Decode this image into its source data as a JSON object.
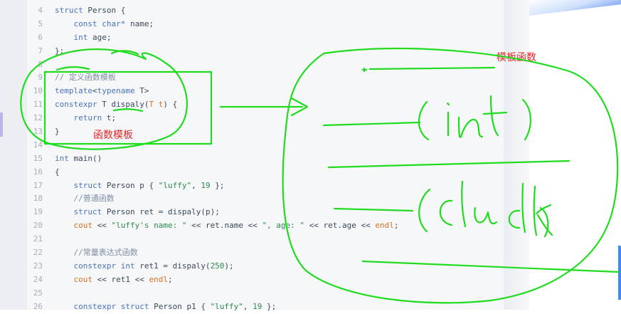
{
  "editor": {
    "lines": [
      {
        "num": "4",
        "parts": [
          [
            "kw",
            "struct"
          ],
          [
            "t",
            " Person {"
          ]
        ]
      },
      {
        "num": "5",
        "parts": [
          [
            "t",
            "    "
          ],
          [
            "kw",
            "const char*"
          ],
          [
            "t",
            " name;"
          ]
        ]
      },
      {
        "num": "6",
        "parts": [
          [
            "t",
            "    "
          ],
          [
            "kw",
            "int"
          ],
          [
            "t",
            " age;"
          ]
        ]
      },
      {
        "num": "7",
        "parts": [
          [
            "t",
            "};"
          ]
        ]
      },
      {
        "num": "8",
        "parts": [
          [
            "t",
            ""
          ]
        ]
      },
      {
        "num": "9",
        "parts": [
          [
            "cmt",
            "// 定义函数模板"
          ]
        ]
      },
      {
        "num": "10",
        "parts": [
          [
            "kw",
            "template"
          ],
          [
            "t",
            "<"
          ],
          [
            "kw",
            "typename"
          ],
          [
            "t",
            " T>"
          ]
        ]
      },
      {
        "num": "11",
        "parts": [
          [
            "kw",
            "constexpr"
          ],
          [
            "t",
            " T "
          ],
          [
            "fn",
            "dispaly"
          ],
          [
            "t",
            "("
          ],
          [
            "param",
            "T t"
          ],
          [
            "t",
            ") {"
          ]
        ]
      },
      {
        "num": "12",
        "parts": [
          [
            "t",
            "    "
          ],
          [
            "kw",
            "return"
          ],
          [
            "t",
            " t;"
          ]
        ]
      },
      {
        "num": "13",
        "parts": [
          [
            "t",
            "}"
          ]
        ]
      },
      {
        "num": "14",
        "parts": [
          [
            "t",
            ""
          ]
        ]
      },
      {
        "num": "15",
        "parts": [
          [
            "kw",
            "int"
          ],
          [
            "t",
            " main()"
          ]
        ]
      },
      {
        "num": "16",
        "parts": [
          [
            "t",
            "{"
          ]
        ]
      },
      {
        "num": "17",
        "parts": [
          [
            "t",
            "    "
          ],
          [
            "kw",
            "struct"
          ],
          [
            "t",
            " Person p { "
          ],
          [
            "str",
            "\"luffy\""
          ],
          [
            "t",
            ", "
          ],
          [
            "num",
            "19"
          ],
          [
            "t",
            " };"
          ]
        ]
      },
      {
        "num": "18",
        "parts": [
          [
            "t",
            "    "
          ],
          [
            "cmt",
            "//普通函数"
          ]
        ]
      },
      {
        "num": "19",
        "parts": [
          [
            "t",
            "    "
          ],
          [
            "kw",
            "struct"
          ],
          [
            "t",
            " Person ret = dispaly(p);"
          ]
        ]
      },
      {
        "num": "20",
        "parts": [
          [
            "t",
            "    "
          ],
          [
            "out",
            "cout"
          ],
          [
            "t",
            " << "
          ],
          [
            "str",
            "\"luffy's name: \""
          ],
          [
            "t",
            " << ret.name << "
          ],
          [
            "str",
            "\", age: \""
          ],
          [
            "t",
            " << ret.age << "
          ],
          [
            "out",
            "endl"
          ],
          [
            "t",
            ";"
          ]
        ]
      },
      {
        "num": "21",
        "parts": [
          [
            "t",
            ""
          ]
        ]
      },
      {
        "num": "22",
        "parts": [
          [
            "t",
            "    "
          ],
          [
            "cmt",
            "//常量表达式函数"
          ]
        ]
      },
      {
        "num": "23",
        "parts": [
          [
            "t",
            "    "
          ],
          [
            "kw",
            "constexpr int"
          ],
          [
            "t",
            " ret1 = dispaly("
          ],
          [
            "num",
            "250"
          ],
          [
            "t",
            ");"
          ]
        ]
      },
      {
        "num": "24",
        "parts": [
          [
            "t",
            "    "
          ],
          [
            "out",
            "cout"
          ],
          [
            "t",
            " << ret1 << "
          ],
          [
            "out",
            "endl"
          ],
          [
            "t",
            ";"
          ]
        ]
      },
      {
        "num": "25",
        "parts": [
          [
            "t",
            ""
          ]
        ]
      },
      {
        "num": "26",
        "parts": [
          [
            "t",
            "    "
          ],
          [
            "kw",
            "constexpr struct"
          ],
          [
            "t",
            " Person p1 { "
          ],
          [
            "str",
            "\"luffy\""
          ],
          [
            "t",
            ", "
          ],
          [
            "num",
            "19"
          ],
          [
            "t",
            " };"
          ]
        ]
      }
    ]
  },
  "annotations": {
    "box_label": "函数模板",
    "right_label": "模板函数",
    "handwriting_int": "(int)",
    "handwriting_class": "(class)"
  },
  "colors": {
    "ink": "#1fdc1f",
    "label_red": "#e12828",
    "accent_blue": "#3b8df5"
  }
}
